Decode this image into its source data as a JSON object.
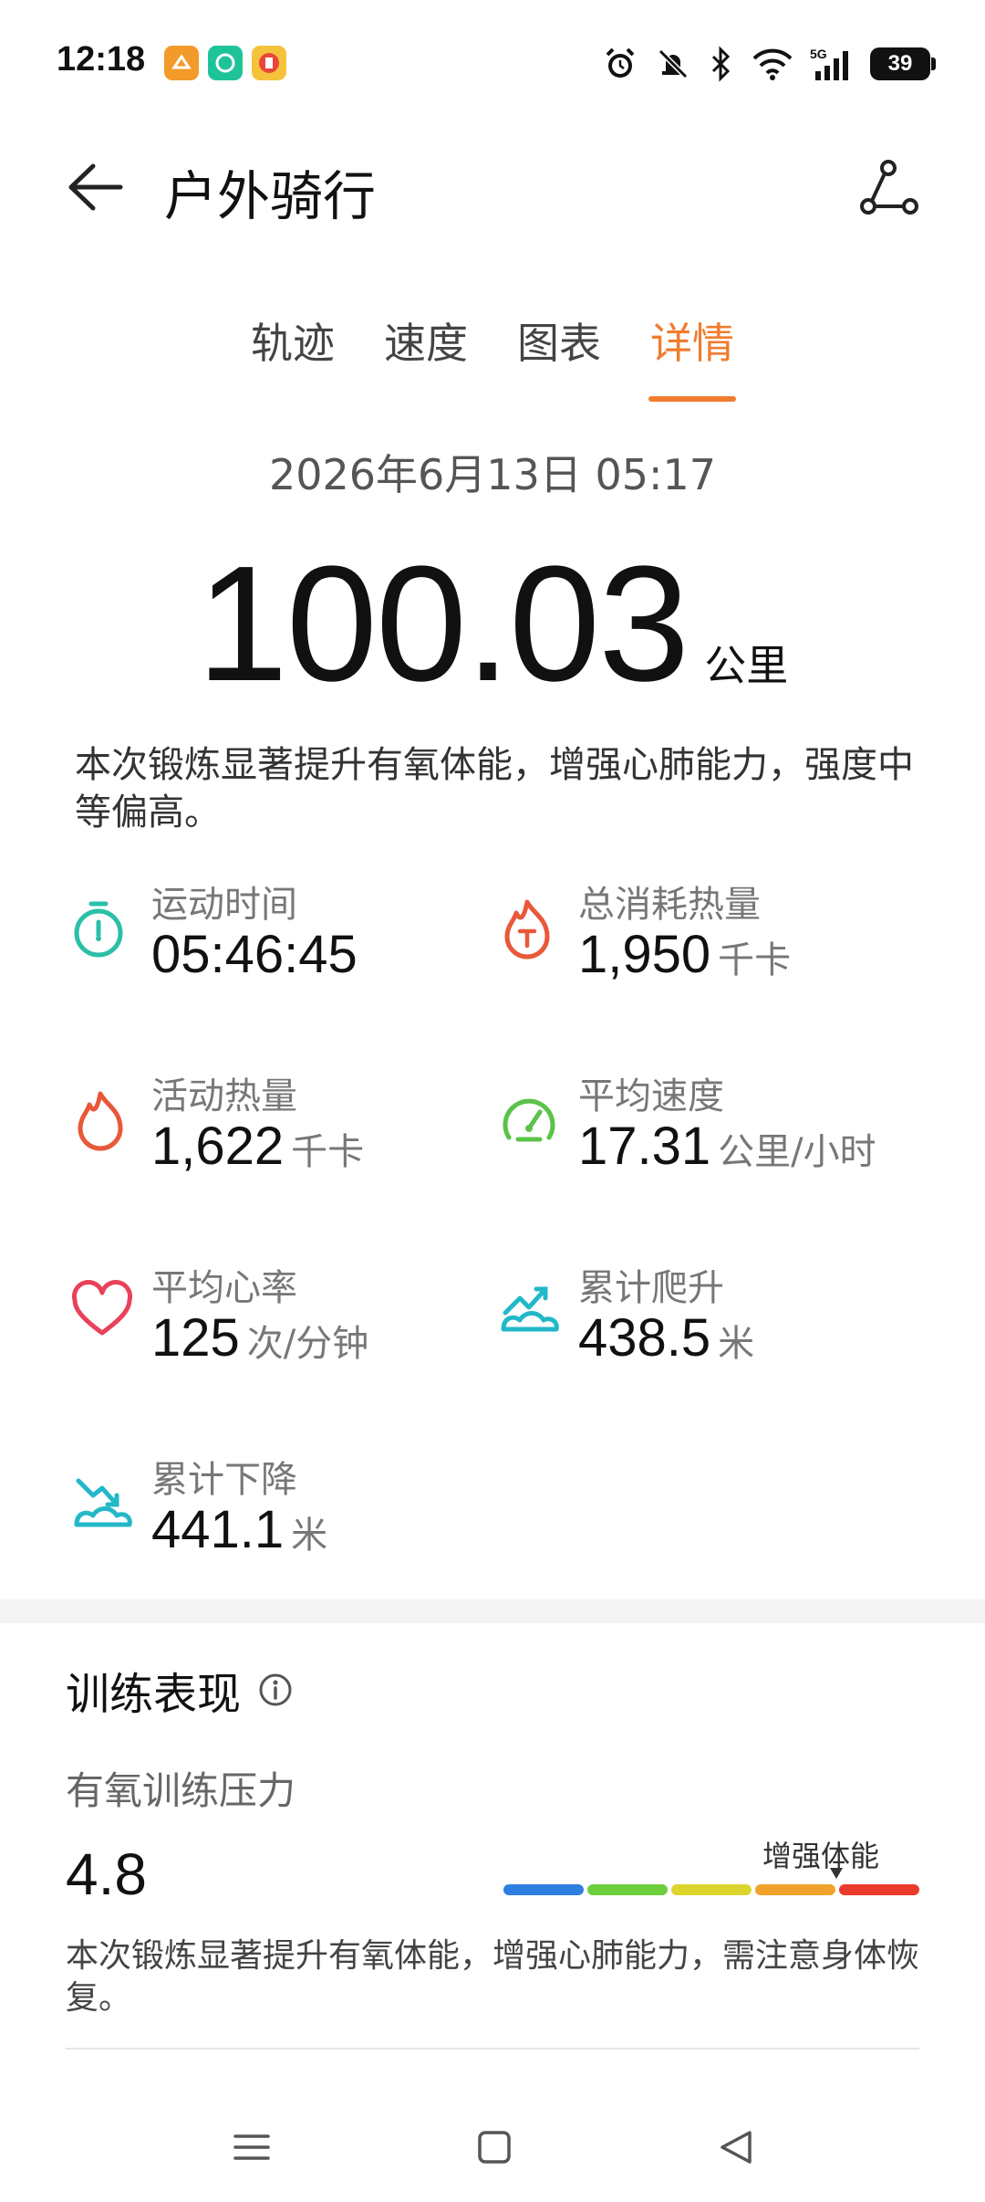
{
  "status_bar": {
    "time": "12:18",
    "battery": "39",
    "icons": [
      "alarm-icon",
      "mute-icon",
      "bluetooth-icon",
      "wifi-icon",
      "5g-signal-icon",
      "battery-icon"
    ]
  },
  "header": {
    "title": "户外骑行",
    "back_icon": "arrow-left-icon",
    "route_icon": "route-share-icon"
  },
  "tabs": [
    {
      "label": "轨迹"
    },
    {
      "label": "速度"
    },
    {
      "label": "图表"
    },
    {
      "label": "详情"
    }
  ],
  "active_tab": "详情",
  "workout": {
    "date": "2026年6月13日 05:17",
    "distance": "100.03",
    "distance_unit": "公里",
    "summary": "本次锻炼显著提升有氧体能，增强心肺能力，强度中等偏高。"
  },
  "metrics": [
    {
      "label": "运动时间",
      "value": "05:46:45",
      "unit": "",
      "icon": "stopwatch-icon",
      "color": "#2bbfa8"
    },
    {
      "label": "总消耗热量",
      "value": "1,950",
      "unit": "千卡",
      "icon": "flame-t-icon",
      "color": "#e8583a"
    },
    {
      "label": "活动热量",
      "value": "1,622",
      "unit": "千卡",
      "icon": "flame-icon",
      "color": "#e8583a"
    },
    {
      "label": "平均速度",
      "value": "17.31",
      "unit": "公里/小时",
      "icon": "speedometer-icon",
      "color": "#5cc24a"
    },
    {
      "label": "平均心率",
      "value": "125",
      "unit": "次/分钟",
      "icon": "heart-icon",
      "color": "#e8425a"
    },
    {
      "label": "累计爬升",
      "value": "438.5",
      "unit": "米",
      "icon": "climb-icon",
      "color": "#22b8c8"
    },
    {
      "label": "累计下降",
      "value": "441.1",
      "unit": "米",
      "icon": "descent-icon",
      "color": "#22b8c8"
    }
  ],
  "training": {
    "title": "训练表现",
    "aerobic_label": "有氧训练压力",
    "aerobic_value": "4.8",
    "scale_label": "增强体能",
    "scale_level": 0.8,
    "scale_colors": [
      "#2f7fe0",
      "#6ccf3c",
      "#dcd42c",
      "#f0a22c",
      "#ec3b2c"
    ],
    "description": "本次锻炼显著提升有氧体能，增强心肺能力，需注意身体恢复。"
  },
  "navbar": {
    "icons": [
      "menu-icon",
      "home-square-icon",
      "back-triangle-icon"
    ]
  },
  "colors": {
    "accent": "#f07c2e"
  }
}
